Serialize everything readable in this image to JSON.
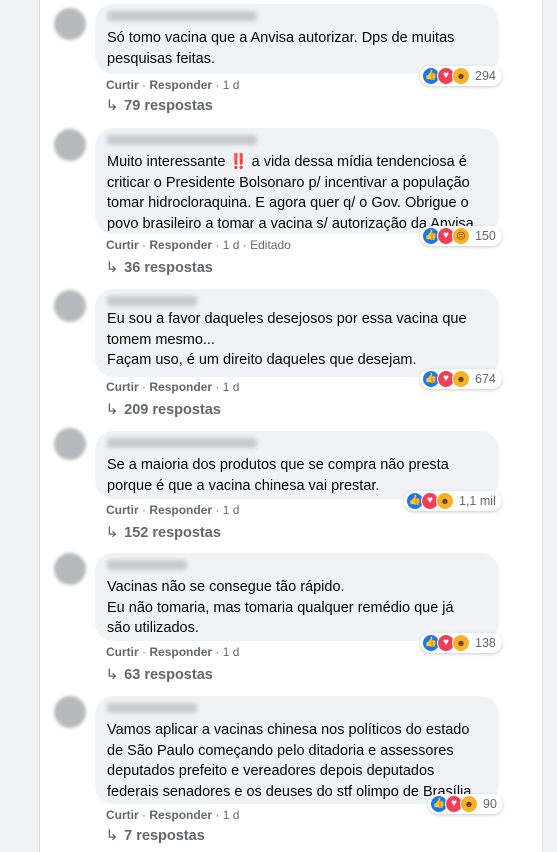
{
  "actions": {
    "like": "Curtir",
    "reply": "Responder",
    "sep": "·"
  },
  "comments": [
    {
      "text": "Só tomo vacina que a Anvisa autorizar. Dps de muitas\npesquisas feitas.",
      "time": "1 d",
      "edited": "",
      "reactions": [
        "like",
        "love",
        "haha"
      ],
      "reaction_count": "294",
      "replies": "79 respostas"
    },
    {
      "text_before": "Muito interessante ",
      "text_emoji": "‼️",
      "text_after": " a vida dessa mídia tendenciosa é\ncriticar o Presidente Bolsonaro p/ incentivar a população\ntomar hidrocloraquina. E agora quer q/ o Gov. Obrigue o\npovo brasileiro a tomar a vacina s/ autorização da Anvisa.",
      "time": "1 d",
      "edited": "Editado",
      "reactions": [
        "like",
        "love",
        "sad"
      ],
      "reaction_count": "150",
      "replies": "36 respostas"
    },
    {
      "text": "Eu sou a favor daqueles desejosos por essa vacina que\ntomem mesmo...\nFaçam uso, é um direito daqueles que desejam.",
      "time": "1 d",
      "edited": "",
      "reactions": [
        "like",
        "love",
        "haha"
      ],
      "reaction_count": "674",
      "replies": "209 respostas"
    },
    {
      "text": "Se a maioria dos produtos que se compra não presta\nporque é que a vacina chinesa vai prestar.",
      "time": "1 d",
      "edited": "",
      "reactions": [
        "like",
        "love",
        "haha"
      ],
      "reaction_count": "1,1 mil",
      "replies": "152 respostas"
    },
    {
      "text": "Vacinas não se consegue tão rápido.\nEu não tomaria, mas tomaria qualquer remédio que já\nsão utilizados.",
      "time": "1 d",
      "edited": "",
      "reactions": [
        "like",
        "love",
        "haha"
      ],
      "reaction_count": "138",
      "replies": "63 respostas"
    },
    {
      "text": "Vamos aplicar a vacinas chinesa nos políticos do estado\nde São Paulo começando pelo ditadoria e assessores\ndeputados prefeito e vereadores depois deputados\nfederais senadores e os deuses do stf olimpo de Brasília",
      "time": "1 d",
      "edited": "",
      "reactions": [
        "like",
        "love",
        "haha"
      ],
      "reaction_count": "90",
      "replies": "7 respostas"
    }
  ]
}
